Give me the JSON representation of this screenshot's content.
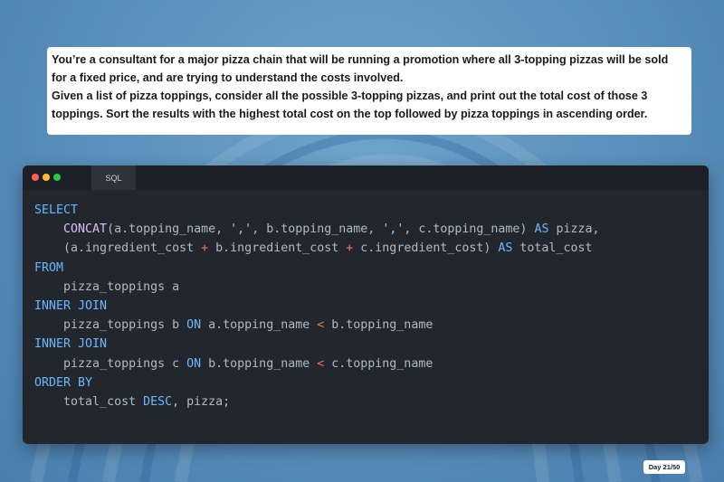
{
  "prompt": {
    "paragraph_1": "You’re a consultant for a major pizza chain that will be running a promotion where all 3-topping pizzas will be sold for a fixed price, and are trying to understand the costs involved.",
    "paragraph_2": "Given a list of pizza toppings, consider all the possible 3-topping pizzas, and print out the total cost of those 3 toppings. Sort the results with the highest total cost on the top followed by pizza toppings in ascending order."
  },
  "editor": {
    "tab_label": "SQL",
    "window_controls": [
      "close-dot",
      "minimize-dot",
      "maximize-dot"
    ],
    "code": {
      "l1": "SELECT",
      "l2_fn": "CONCAT",
      "l2_a": "(a.topping_name, ",
      "l2_str1": "','",
      "l2_b": ", b.topping_name, ",
      "l2_str2": "','",
      "l2_c": ", c.topping_name) ",
      "l2_as": "AS",
      "l2_d": " pizza,",
      "l3_a": "(a.ingredient_cost ",
      "l3_op1": "+",
      "l3_b": " b.ingredient_cost ",
      "l3_op2": "+",
      "l3_c": " c.ingredient_cost) ",
      "l3_as": "AS",
      "l3_d": " total_cost",
      "l4": "FROM",
      "l5": "pizza_toppings a",
      "l6": "INNER JOIN",
      "l7_a": "pizza_toppings b ",
      "l7_on": "ON",
      "l7_b": " a.topping_name ",
      "l7_op": "<",
      "l7_c": " b.topping_name",
      "l8": "INNER JOIN",
      "l9_a": "pizza_toppings c ",
      "l9_on": "ON",
      "l9_b": " b.topping_name ",
      "l9_op": "<",
      "l9_c": " c.topping_name",
      "l10": "ORDER BY",
      "l11_a": "total_cost ",
      "l11_desc": "DESC",
      "l11_b": ", pizza;"
    }
  },
  "badge": {
    "label": "Day 21/50"
  },
  "colors": {
    "keyword": "#6cb6ff",
    "function": "#dcbdfb",
    "operator": "#f47067",
    "string": "#96d0ff",
    "editor_bg": "#22272e"
  }
}
